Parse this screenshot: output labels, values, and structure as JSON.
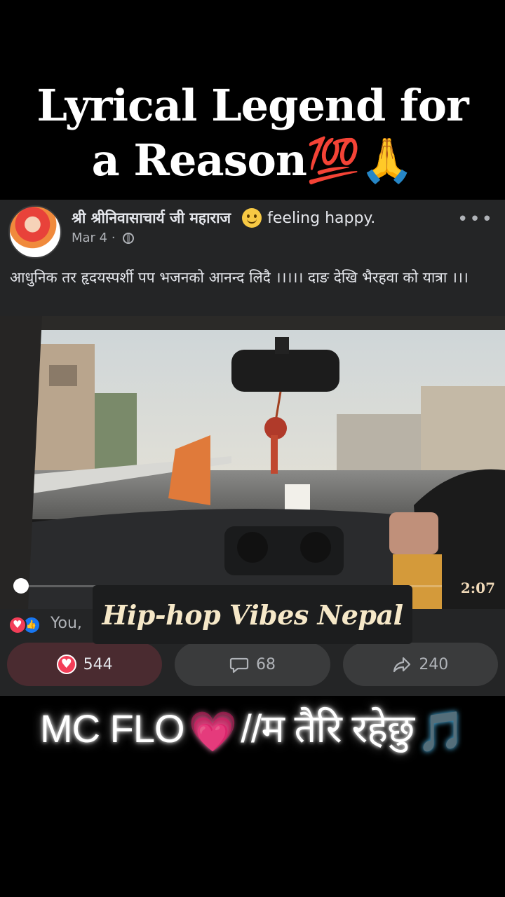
{
  "overlay_title": {
    "line1": "Lyrical Legend for",
    "line2": "a Reason💯🙏"
  },
  "post": {
    "author": "श्री श्रीनिवासाचार्य जी महाराज",
    "feeling": "feeling happy.",
    "date": "Mar 4 ·",
    "more": "•••",
    "text": "आधुनिक तर हृदयस्पर्शी पप भजनको आनन्द लिदै ।।।।। दाङ देखि भैरहवा को यात्रा ।।।",
    "video": {
      "duration": "2:07",
      "progress": 0.0
    },
    "reactions_text": "You, ",
    "brand_overlay": "Hip-hop Vibes Nepal",
    "actions": {
      "like_count": "544",
      "comment_count": "68",
      "share_count": "240"
    }
  },
  "bottom_caption": {
    "text_left": "MC FLO",
    "heart": "💗",
    "text_right": "//म तैरि रहेछु",
    "note": "🎵"
  },
  "colors": {
    "card_bg": "#242526",
    "like_red": "#f33e58",
    "like_blue": "#1877f2",
    "muted_text": "#b0b3b8"
  }
}
